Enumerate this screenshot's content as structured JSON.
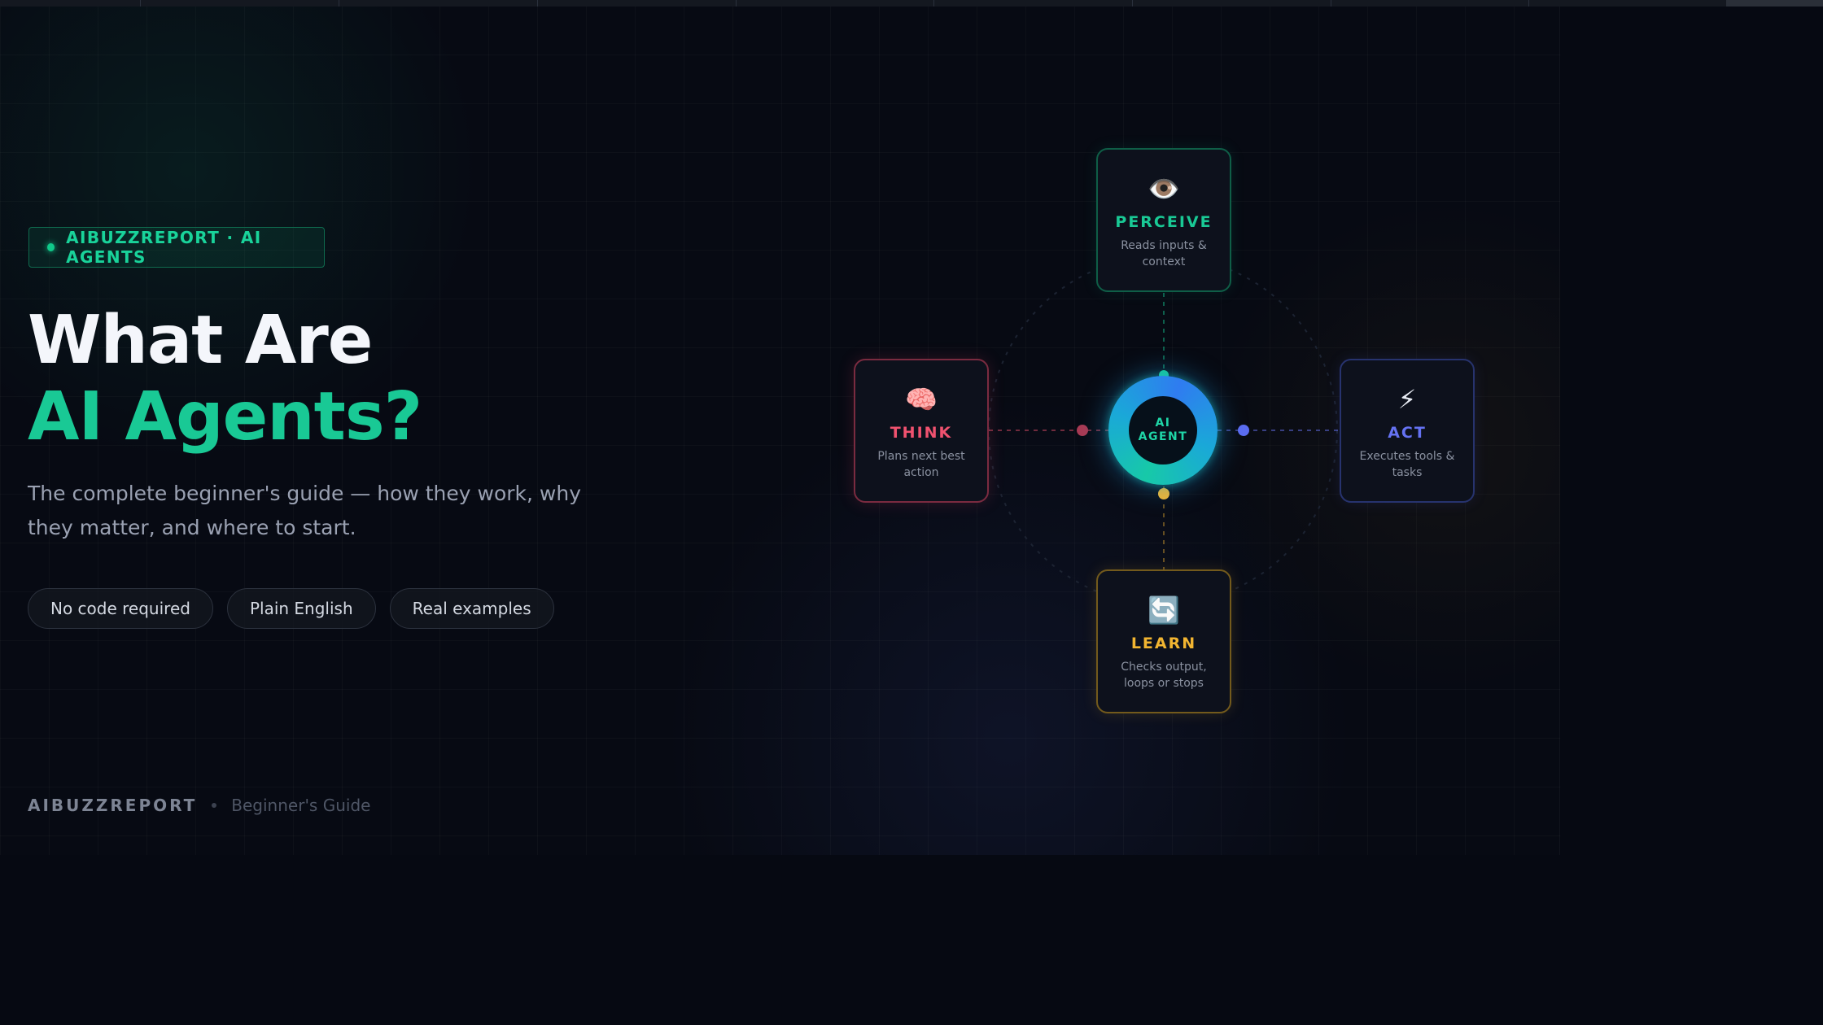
{
  "badge": {
    "text": "AIBUZZREPORT · AI AGENTS"
  },
  "title": {
    "line1": "What Are",
    "line2": "AI Agents?"
  },
  "subtitle": {
    "line1": "The complete beginner's guide — how they work, why",
    "line2": "they matter, and where to start."
  },
  "pills": [
    "No code required",
    "Plain English",
    "Real examples"
  ],
  "footer": {
    "brand": "AIBUZZREPORT",
    "label": "Beginner's Guide"
  },
  "diagram": {
    "core": {
      "line1": "AI",
      "line2": "AGENT"
    },
    "nodes": [
      {
        "key": "perceive",
        "icon": "eye-icon",
        "glyph": "👁️",
        "name": "PERCEIVE",
        "desc": "Reads inputs & context",
        "color": "#19c995"
      },
      {
        "key": "think",
        "icon": "brain-icon",
        "glyph": "🧠",
        "name": "THINK",
        "desc": "Plans next best action",
        "color": "#f0526f"
      },
      {
        "key": "act",
        "icon": "lightning-icon",
        "glyph": "⚡",
        "name": "ACT",
        "desc": "Executes tools & tasks",
        "color": "#6572f2"
      },
      {
        "key": "learn",
        "icon": "refresh-icon",
        "glyph": "🔄",
        "name": "LEARN",
        "desc": "Checks output, loops or stops",
        "color": "#f2b531"
      }
    ]
  },
  "colors": {
    "accent": "#19c995",
    "background": "#070a13"
  }
}
